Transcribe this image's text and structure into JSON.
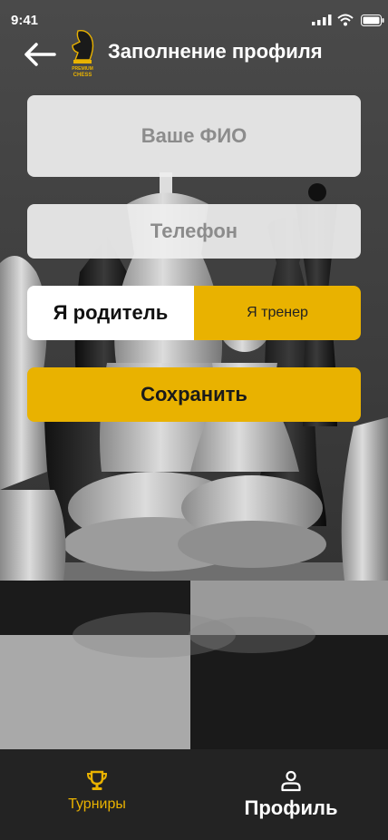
{
  "status_bar": {
    "time": "9:41"
  },
  "header": {
    "title": "Заполнение профиля",
    "logo_text_top": "PREMIUM",
    "logo_text_bottom": "CHESS"
  },
  "form": {
    "name_placeholder": "Ваше ФИО",
    "phone_placeholder": "Телефон",
    "role_parent": "Я родитель",
    "role_coach": "Я тренер",
    "selected_role": "Я родитель",
    "save_label": "Сохранить"
  },
  "tabbar": {
    "tabs": [
      {
        "label": "Турниры",
        "icon": "trophy-icon",
        "active": false
      },
      {
        "label": "Профиль",
        "icon": "person-icon",
        "active": true
      }
    ]
  },
  "colors": {
    "accent": "#e9b200",
    "tabbar": "#232323",
    "field": "#eeeeee",
    "text": "#ffffff"
  }
}
